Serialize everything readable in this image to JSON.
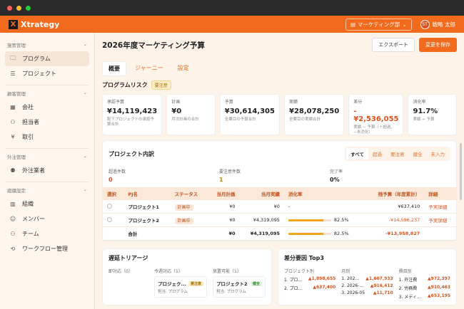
{
  "app": {
    "name": "Xtrategy",
    "logo_letter": "X",
    "dept": "マーケティング部",
    "user_initials": "ST",
    "user_name": "戦略 太郎"
  },
  "sidebar": {
    "sections": [
      {
        "title": "施策管理",
        "items": [
          {
            "label": "プログラム",
            "icon": "folder-icon",
            "active": true
          },
          {
            "label": "プロジェクト",
            "icon": "list-icon"
          }
        ]
      },
      {
        "title": "顧客管理",
        "items": [
          {
            "label": "会社",
            "icon": "building-icon"
          },
          {
            "label": "担当者",
            "icon": "people-icon"
          },
          {
            "label": "取引",
            "icon": "yen-icon"
          }
        ]
      },
      {
        "title": "外注管理",
        "items": [
          {
            "label": "外注業者",
            "icon": "vendor-icon"
          }
        ]
      },
      {
        "title": "組織設定",
        "items": [
          {
            "label": "組織",
            "icon": "org-icon"
          },
          {
            "label": "メンバー",
            "icon": "person-icon"
          },
          {
            "label": "チーム",
            "icon": "team-icon"
          },
          {
            "label": "ワークフロー管理",
            "icon": "workflow-icon"
          }
        ]
      }
    ]
  },
  "page": {
    "title": "2026年度マーケティング予算",
    "export_label": "エクスポート",
    "save_label": "変更を保存"
  },
  "tabs": [
    "概要",
    "ジャーニー",
    "設定"
  ],
  "risk": {
    "title": "プログラムリスク",
    "badge": "要注意"
  },
  "kpis": [
    {
      "label": "承認予算",
      "value": "¥14,119,423",
      "sub": "配下プロジェクトの承認予算合計"
    },
    {
      "label": "計画",
      "value": "¥0",
      "sub": "月次計画の合計"
    },
    {
      "label": "予算",
      "value": "¥30,614,305",
      "sub": "全費目の予算合計"
    },
    {
      "label": "実績",
      "value": "¥28,078,250",
      "sub": "全費目の実績合計"
    },
    {
      "label": "差分",
      "value": "-¥2,536,055",
      "sub": "実績 − 予算（＋超過、−未消化）",
      "negative": true
    },
    {
      "label": "消化率",
      "value": "91.7%",
      "sub": "実績 ÷ 予算"
    }
  ],
  "projects": {
    "title": "プロジェクト内訳",
    "filters": [
      "すべて",
      "超過",
      "要注意",
      "健全",
      "未入力"
    ],
    "stats": [
      {
        "label": "超過件数",
        "value": "0",
        "color": "#d9531e"
      },
      {
        "label": "要注意件数",
        "value": "1",
        "color": "#c98a00"
      },
      {
        "label": "完了率",
        "value": "0%",
        "color": "#222"
      }
    ],
    "columns": [
      "選択",
      "PJ名",
      "ステータス",
      "当月計画",
      "当月実績",
      "消化率",
      "残予算（年度累計）",
      "詳細"
    ],
    "rows": [
      {
        "name": "プロジェクト1",
        "status": "計画中",
        "plan": "¥0",
        "actual": "¥0",
        "rate": "-",
        "rate_num": 0,
        "remain": "¥637,410",
        "remain_neg": false,
        "detail": "予実詳細"
      },
      {
        "name": "プロジェクト2",
        "status": "計画中",
        "plan": "¥0",
        "actual": "¥4,319,095",
        "rate": "82.5%",
        "rate_num": 0.825,
        "remain": "-¥14,596,237",
        "remain_neg": true,
        "detail": "予実詳細"
      }
    ],
    "total": {
      "label": "合計",
      "plan": "¥0",
      "actual": "¥4,319,095",
      "rate": "82.5%",
      "rate_num": 0.825,
      "remain": "-¥13,958,827"
    }
  },
  "triage": {
    "title": "遅延トリアージ",
    "cols": [
      {
        "label": "即対応（0）",
        "cards": []
      },
      {
        "label": "今週対応（1）",
        "cards": [
          {
            "title": "プロジェク...",
            "chip": "要注意",
            "chip_type": "warn",
            "sub": "担当: プログラム"
          }
        ]
      },
      {
        "label": "放置可能（1）",
        "cards": [
          {
            "title": "プロジェクト2",
            "chip": "健全",
            "chip_type": "ok",
            "sub": "担当: プログラム"
          }
        ]
      }
    ]
  },
  "variance": {
    "title": "差分要因 Top3",
    "cols": [
      {
        "label": "プロジェクト別",
        "rows": [
          {
            "name": "1. プロ...",
            "value": "▲1,898,655"
          },
          {
            "name": "2. プロ...",
            "value": "▲637,400"
          }
        ]
      },
      {
        "label": "月別",
        "rows": [
          {
            "name": "1. 202...",
            "value": "▲1,607,933"
          },
          {
            "name": "2. 2026-...",
            "value": "▲916,412"
          },
          {
            "name": "3. 2026-05",
            "value": "▲11,710"
          }
        ]
      },
      {
        "label": "費目別",
        "rows": [
          {
            "name": "1. 外注費",
            "value": "▲972,397"
          },
          {
            "name": "2. 労務費",
            "value": "▲910,463"
          },
          {
            "name": "3. メディ...",
            "value": "▲653,195"
          }
        ]
      }
    ]
  }
}
